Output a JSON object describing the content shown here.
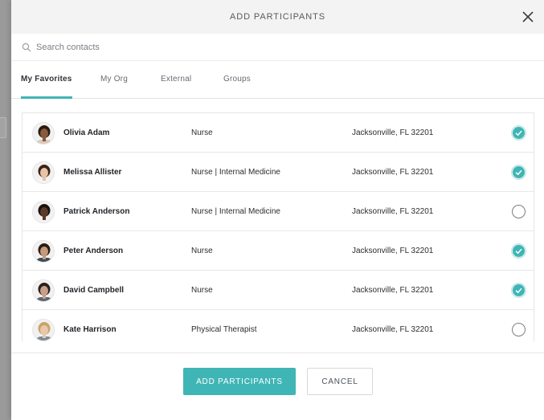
{
  "modal": {
    "title": "ADD PARTICIPANTS",
    "close_icon": "close-icon"
  },
  "search": {
    "placeholder": "Search contacts",
    "value": "",
    "icon": "search-icon"
  },
  "tabs": [
    {
      "label": "My Favorites",
      "active": true
    },
    {
      "label": "My Org",
      "active": false
    },
    {
      "label": "External",
      "active": false
    },
    {
      "label": "Groups",
      "active": false
    }
  ],
  "contacts": [
    {
      "name": "Olivia Adam",
      "role": "Nurse",
      "location": "Jacksonville, FL 32201",
      "selected": true,
      "skin": "#8a5a3c",
      "hair": "#2a1a12",
      "shirt": "#d9c9b6"
    },
    {
      "name": "Melissa Allister",
      "role": "Nurse | Internal Medicine",
      "location": "Jacksonville, FL 32201",
      "selected": true,
      "skin": "#e8c3a6",
      "hair": "#3a2418",
      "shirt": "#f4f4f4"
    },
    {
      "name": "Patrick Anderson",
      "role": "Nurse | Internal Medicine",
      "location": "Jacksonville, FL 32201",
      "selected": false,
      "skin": "#5a3a28",
      "hair": "#1a120e",
      "shirt": "#f2f2f2"
    },
    {
      "name": "Peter Anderson",
      "role": "Nurse",
      "location": "Jacksonville, FL 32201",
      "selected": true,
      "skin": "#c79a7a",
      "hair": "#2a1c14",
      "shirt": "#3b4a5a"
    },
    {
      "name": "David Campbell",
      "role": "Nurse",
      "location": "Jacksonville, FL 32201",
      "selected": true,
      "skin": "#caa088",
      "hair": "#2a211c",
      "shirt": "#5b6470"
    },
    {
      "name": "Kate Harrison",
      "role": "Physical Therapist",
      "location": "Jacksonville, FL 32201",
      "selected": false,
      "skin": "#e9c8ad",
      "hair": "#c9a46a",
      "shirt": "#7a8a9a"
    }
  ],
  "footer": {
    "add_label": "ADD PARTICIPANTS",
    "cancel_label": "CANCEL"
  },
  "colors": {
    "accent": "#3fb5b5",
    "header_bg": "#f3f3f3"
  }
}
